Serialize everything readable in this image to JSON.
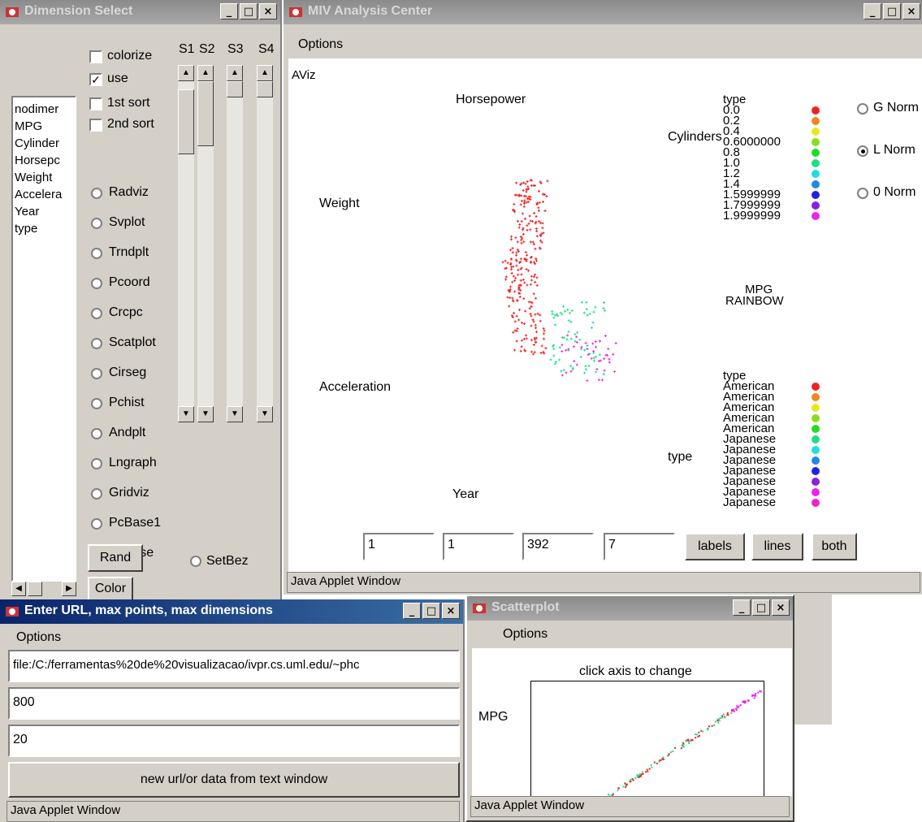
{
  "dimension_select": {
    "title": "Dimension Select",
    "dims": [
      "nodimer",
      "MPG",
      "Cylinder",
      "Horsepc",
      "Weight",
      "Accelera",
      "Year",
      "type"
    ],
    "checks": [
      {
        "label": "colorize",
        "checked": false
      },
      {
        "label": "use",
        "checked": true
      },
      {
        "label": "1st sort",
        "checked": false
      },
      {
        "label": "2nd sort",
        "checked": false
      }
    ],
    "methods": [
      "Radviz",
      "Svplot",
      "Trndplt",
      "Pcoord",
      "Crcpc",
      "Scatplot",
      "Cirseg",
      "Pchist",
      "Andplt",
      "Lngraph",
      "Gridviz",
      "PcBase1",
      "PcBase"
    ],
    "slider_labels": [
      "S1",
      "S2",
      "S3",
      "S4"
    ],
    "rand_label": "Rand",
    "color_label": "Color",
    "setbez_label": "SetBez"
  },
  "miv": {
    "title": "MIV Analysis Center",
    "menu": "Options",
    "canvas_title": "AViz",
    "anchors": [
      "Horsepower",
      "Weight",
      "Acceleration",
      "Year",
      "Cylinders",
      "type"
    ],
    "mpg_legend": {
      "header": "type",
      "labels": [
        "0.0",
        "0.2",
        "0.4",
        "0.6000000",
        "0.8",
        "1.0",
        "1.2",
        "1.4",
        "1.5999999",
        "1.7999999",
        "1.9999999"
      ]
    },
    "type_legend": {
      "header": "type",
      "labels": [
        "American",
        "American",
        "American",
        "American",
        "American",
        "Japanese",
        "Japanese",
        "Japanese",
        "Japanese",
        "Japanese",
        "Japanese",
        "Japanese"
      ]
    },
    "legend_colors": [
      "#ee2222",
      "#ee8822",
      "#e8e822",
      "#88dd22",
      "#22dd22",
      "#22dd88",
      "#22dddd",
      "#2288ee",
      "#2222dd",
      "#8822dd",
      "#ee22ee",
      "#ee22cc"
    ],
    "mpg_label": "MPG",
    "rainbow_label": "RAINBOW",
    "norm_options": [
      {
        "label": "G Norm",
        "selected": false
      },
      {
        "label": "L Norm",
        "selected": true
      },
      {
        "label": "0 Norm",
        "selected": false
      }
    ],
    "fields": [
      "1",
      "1",
      "392",
      "7"
    ],
    "buttons": [
      "labels",
      "lines",
      "both"
    ],
    "status": "Java Applet Window"
  },
  "url_window": {
    "title": "Enter URL, max points, max dimensions",
    "menu": "Options",
    "url": "file:/C:/ferramentas%20de%20visualizacao/ivpr.cs.uml.edu/~phc",
    "max_points": "800",
    "max_dims": "20",
    "button": "new url/or data from text window",
    "status": "Java Applet Window"
  },
  "scatterplot": {
    "title": "Scatterplot",
    "menu": "Options",
    "hint": "click axis to change",
    "ylabel": "MPG",
    "status": "Java Applet Window"
  },
  "scatter_colors": [
    "#ee2222",
    "#22dd88",
    "#ee22ee"
  ]
}
